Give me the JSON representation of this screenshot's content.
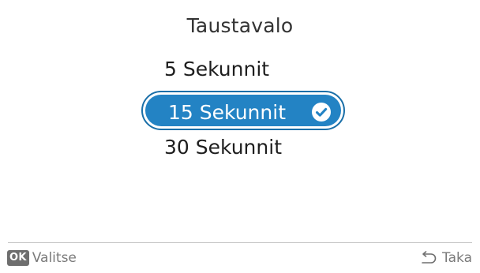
{
  "screen": {
    "title": "Taustavalo"
  },
  "options": [
    {
      "label": "5 Sekunnit",
      "selected": false
    },
    {
      "label": "15 Sekunnit",
      "selected": true
    },
    {
      "label": "30 Sekunnit",
      "selected": false
    }
  ],
  "footer": {
    "ok_badge": "OK",
    "select_label": "Valitse",
    "back_label": "Taka"
  },
  "icons": {
    "selected": "check-circle-icon",
    "back": "back-arrow-icon"
  },
  "colors": {
    "accent": "#2383c4",
    "accent_border": "#1a6fa8",
    "badge_bg": "#6e6e6e",
    "footer_text": "#7a7a7a"
  }
}
